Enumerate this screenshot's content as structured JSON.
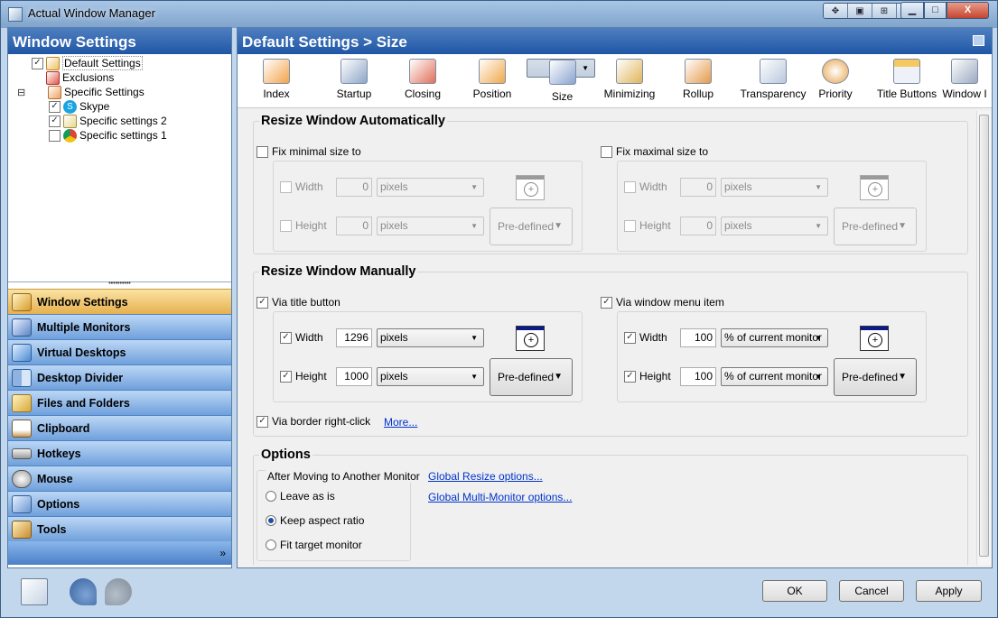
{
  "app": {
    "title": "Actual Window Manager",
    "extra_buttons": [
      "✥",
      "▣",
      "⊞",
      "⊡"
    ],
    "min": "▁",
    "max": "□",
    "close": "X"
  },
  "left_panel": {
    "title": "Window Settings",
    "splitter": "••••••••••"
  },
  "tree": [
    {
      "label": "Default Settings",
      "checked": "✓"
    },
    {
      "label": "Exclusions"
    },
    {
      "label": "Specific Settings",
      "expander": "⊟"
    },
    {
      "label": "Skype",
      "checked": "✓"
    },
    {
      "label": "Specific settings 2",
      "checked": "✓"
    },
    {
      "label": "Specific settings 1",
      "checked": ""
    }
  ],
  "nav": {
    "items": [
      "Window Settings",
      "Multiple Monitors",
      "Virtual Desktops",
      "Desktop Divider",
      "Files and Folders",
      "Clipboard",
      "Hotkeys",
      "Mouse",
      "Options",
      "Tools"
    ],
    "more": "»"
  },
  "right_panel": {
    "title": "Default Settings > Size"
  },
  "toolbar": [
    "Index",
    "Startup",
    "Closing",
    "Position",
    "Size",
    "Minimizing",
    "Rollup",
    "Transparency",
    "Priority",
    "Title Buttons",
    "Window I"
  ],
  "auto": {
    "title": "Resize Window Automatically",
    "min": {
      "label": "Fix minimal size to",
      "width_label": "Width",
      "width": "0",
      "width_unit": "pixels",
      "height_label": "Height",
      "height": "0",
      "height_unit": "pixels",
      "predefined": "Pre-defined"
    },
    "max": {
      "label": "Fix maximal size to",
      "width_label": "Width",
      "width": "0",
      "width_unit": "pixels",
      "height_label": "Height",
      "height": "0",
      "height_unit": "pixels",
      "predefined": "Pre-defined"
    }
  },
  "manual": {
    "title": "Resize Window Manually",
    "title_button": {
      "label": "Via title button",
      "width_label": "Width",
      "width": "1296",
      "width_unit": "pixels",
      "height_label": "Height",
      "height": "1000",
      "height_unit": "pixels",
      "predefined": "Pre-defined"
    },
    "menu_item": {
      "label": "Via window menu item",
      "width_label": "Width",
      "width": "100",
      "width_unit": "% of current monitor",
      "height_label": "Height",
      "height": "100",
      "height_unit": "% of current monitor",
      "predefined": "Pre-defined"
    },
    "border": {
      "label": "Via border right-click",
      "more": "More..."
    }
  },
  "options": {
    "title": "Options",
    "group_title": "After Moving to Another Monitor",
    "radios": [
      "Leave as is",
      "Keep aspect ratio",
      "Fit target monitor"
    ],
    "selected": "Keep aspect ratio",
    "link1": "Global Resize options...",
    "link2": "Global Multi-Monitor options..."
  },
  "check": "✓",
  "footer": {
    "ok": "OK",
    "cancel": "Cancel",
    "apply": "Apply"
  }
}
